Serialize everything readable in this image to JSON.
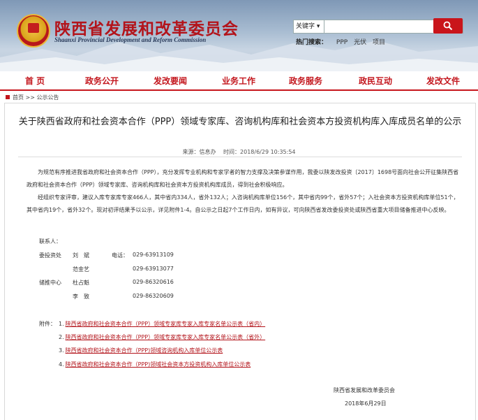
{
  "header": {
    "site_title": "陕西省发展和改革委员会",
    "site_subtitle": "Shaanxi Provincial Development and Reform Commission",
    "search": {
      "select_value": "关键字 ▾",
      "placeholder": "",
      "button_icon": "search-icon"
    },
    "hot_search": {
      "label": "热门搜索：",
      "terms": [
        "PPP",
        "光伏",
        "项目"
      ]
    }
  },
  "nav": {
    "items": [
      "首 页",
      "政务公开",
      "发改要闻",
      "业务工作",
      "政务服务",
      "政民互动",
      "发改文件"
    ]
  },
  "breadcrumb": {
    "home": "首页",
    "separator": ">>",
    "current": "公示公告"
  },
  "article": {
    "title": "关于陕西省政府和社会资本合作（PPP）领域专家库、咨询机构库和社会资本方投资机构库入库成员名单的公示",
    "source": "来源：信息办",
    "time": "时间：2018/6/29 10:35:54",
    "para1": "为规范有序推进我省政府和社会资本合作（PPP），充分发挥专业机构和专家学者的智力支撑及决策参谋作用，我委以陕发改投资〔2017〕1698号面向社会公开征集陕西省政府和社会资本合作（PPP）领域专家库、咨询机构库和社会资本方投资机构库成员，得到社会积极响应。",
    "para2": "经组织专家评审，建议入库专家库专家466人，其中省内334人，省外132人；入咨询机构库单位156个，其中省内99个，省外57个；入社会资本方投资机构库单位51个，其中省内19个，省外32个。现对初评结果予以公示，详见附件1-4。自公示之日起7个工作日内，如有异议，可向陕西省发改委投资处或陕西省重大项目储备推进中心反映。",
    "contact_label": "联系人：",
    "contacts": [
      {
        "dept": "委投资处",
        "name": "刘　斌",
        "phone_label": "电话：",
        "phone": "029-63913109"
      },
      {
        "dept": "",
        "name": "范金艺",
        "phone_label": "",
        "phone": "029-63913077"
      },
      {
        "dept": "储推中心",
        "name": "杜占魁",
        "phone_label": "",
        "phone": "029-86320616"
      },
      {
        "dept": "",
        "name": "李　致",
        "phone_label": "",
        "phone": "029-86320609"
      }
    ],
    "attachments_label": "附件：",
    "attachments": [
      {
        "num": "1.",
        "text": "陕西省政府和社会资本合作（PPP）领域专家库专家入库专家名单公示表（省内）"
      },
      {
        "num": "2.",
        "text": "陕西省政府和社会资本合作（PPP）领域专家库专家入库专家名单公示表（省外）"
      },
      {
        "num": "3.",
        "text": "陕西省政府和社会资本合作（PPP)领域咨询机构入库单位公示表"
      },
      {
        "num": "4.",
        "text": "陕西省政府和社会资本合作（PPP)领域社会资本方投资机构入库单位公示表"
      }
    ],
    "signature_org": "陕西省发展和改革委员会",
    "signature_date": "2018年6月29日"
  },
  "colors": {
    "brand_red": "#c3161d",
    "link_red": "#b3141b"
  }
}
